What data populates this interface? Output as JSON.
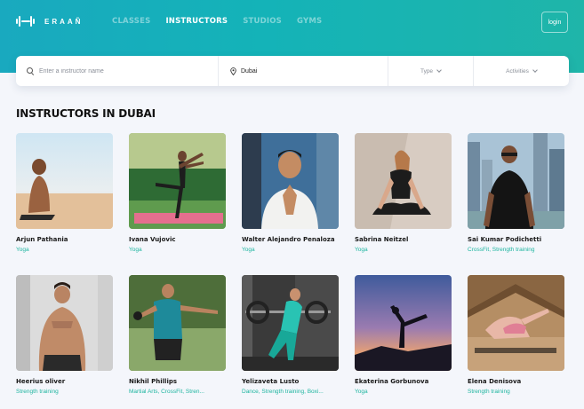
{
  "brand": {
    "name": "ERAAÑ"
  },
  "nav": {
    "items": [
      {
        "label": "CLASSES",
        "active": false
      },
      {
        "label": "INSTRUCTORS",
        "active": true
      },
      {
        "label": "STUDIOS",
        "active": false
      },
      {
        "label": "GYMS",
        "active": false
      }
    ],
    "login_label": "login"
  },
  "search": {
    "placeholder": "Enter a instructor name",
    "location": "Dubai",
    "type_label": "Type",
    "activities_label": "Activities"
  },
  "section": {
    "title": "INSTRUCTORS IN DUBAI"
  },
  "instructors": [
    {
      "name": "Arjun Pathania",
      "tags": "Yoga"
    },
    {
      "name": "Ivana Vujovic",
      "tags": "Yoga"
    },
    {
      "name": "Walter Alejandro Penaloza",
      "tags": "Yoga"
    },
    {
      "name": "Sabrina Neitzel",
      "tags": "Yoga"
    },
    {
      "name": "Sai Kumar Podichetti",
      "tags": "CrossFit, Strength training"
    },
    {
      "name": "Heerius oliver",
      "tags": "Strength training"
    },
    {
      "name": "Nikhil Phillips",
      "tags": "Martial Arts, CrossFit, Stren..."
    },
    {
      "name": "Yelizaveta Lusto",
      "tags": "Dance, Strength training, Boxi..."
    },
    {
      "name": "Ekaterina Gorbunova",
      "tags": "Yoga"
    },
    {
      "name": "Elena Denisova",
      "tags": "Strength training"
    }
  ],
  "colors": {
    "accent": "#1fb5a0",
    "header_start": "#19a9bf",
    "header_end": "#1fb5a9"
  },
  "icons": {
    "search": "search-icon",
    "location": "map-pin-icon",
    "dropdown": "chevron-down-icon"
  }
}
